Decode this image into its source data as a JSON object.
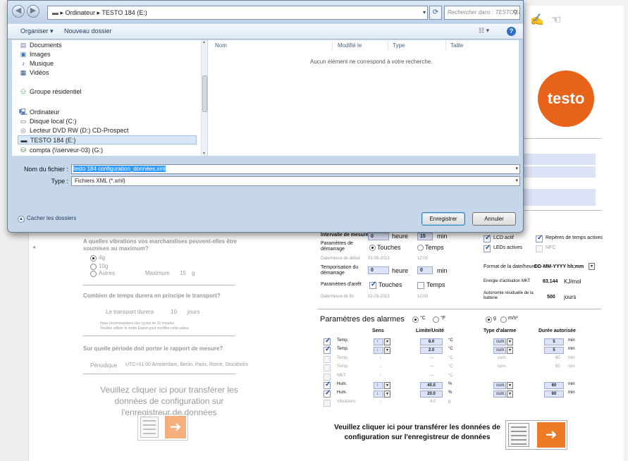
{
  "dialog": {
    "address": "▸ Ordinateur ▸ TESTO 184 (E:)",
    "search_placeholder": "Rechercher dans : TESTO 184 (E:)",
    "organize_label": "Organiser ▾",
    "new_folder_label": "Nouveau dossier",
    "nav_items": [
      {
        "label": "Documents",
        "icon": "documents-icon"
      },
      {
        "label": "Images",
        "icon": "images-icon"
      },
      {
        "label": "Musique",
        "icon": "music-icon"
      },
      {
        "label": "Vidéos",
        "icon": "videos-icon"
      },
      {
        "label": "Groupe résidentiel",
        "icon": "homegroup-icon"
      },
      {
        "label": "Ordinateur",
        "icon": "computer-icon"
      },
      {
        "label": "Disque local (C:)",
        "icon": "drive-icon"
      },
      {
        "label": "Lecteur DVD RW (D:) CD-Prospect",
        "icon": "dvd-icon"
      },
      {
        "label": "TESTO 184 (E:)",
        "icon": "usb-drive-icon"
      },
      {
        "label": "compta (\\\\serveur-03) (G:)",
        "icon": "network-drive-icon"
      }
    ],
    "columns": [
      "Nom",
      "Modifié le",
      "Type",
      "Taille"
    ],
    "empty_message": "Aucun élément ne correspond à votre recherche.",
    "filename_label": "Nom du fichier :",
    "filename_value": "testo 184 configuration_données.xml",
    "type_label": "Type :",
    "type_value": "Fichiers XML (*.xml)",
    "hide_folders_label": "Cacher les dossiers",
    "save_label": "Enregistrer",
    "cancel_label": "Annuler"
  },
  "background": {
    "logo_text": "testo",
    "vibrations_question": "A quelles vibrations vos marchandises peuvent-elles être soumises au maximum?",
    "vib_opt1": "4g",
    "vib_opt2": "10g",
    "vib_opt3": "Autres",
    "vib_max_label": "Maximum",
    "vib_max_value": "15",
    "vib_max_unit": "g",
    "duration_question": "Combien de temps durera en principe le transport?",
    "duration_label": "Le transport durera",
    "duration_value": "10",
    "duration_unit": "jours",
    "duration_note1": "Nous recommandons des cycles de 15 minutes.",
    "duration_note2": "Veuillez utiliser le mode Expert pour modifier cette valeur.",
    "period_question": "Sur quelle période doit porter le rapport de mesure?",
    "period_label": "Périodique",
    "period_value": "UTC+01:00 Amsterdam, Berlin, Paris, Rome, Stockholm",
    "transfer_left": "Veuillez cliquer ici pour transférer les données de configuration sur l'enregistreur de données",
    "measure_interval_label": "Intervalle de mesure",
    "measure_interval_h": "0",
    "measure_interval_h_unit": "heure",
    "measure_interval_m": "15",
    "measure_interval_m_unit": "min",
    "start_params_label": "Paramètres de démarrage",
    "start_opt_keys": "Touches",
    "start_opt_time": "Temps",
    "start_date_label": "Date/Heure de début",
    "start_date": "01-09-2013",
    "start_time": "12:00",
    "start_delay_label": "Temporisation du démarrage",
    "start_delay_h": "0",
    "start_delay_h_unit": "heure",
    "start_delay_m": "0",
    "start_delay_m_unit": "min",
    "stop_params_label": "Paramètres d'arrêt",
    "stop_opt_keys": "Touches",
    "stop_opt_time": "Temps",
    "end_date_label": "Date/Heure de fin",
    "end_date": "02-09-2013",
    "end_time": "12:00",
    "lcd_label": "LCD actif",
    "time_marks_label": "Repères de temps actives",
    "leds_label": "LEDs actives",
    "nfc_label": "NFC",
    "datetime_format_label": "Format de la date/heure",
    "datetime_format_value": "DD-MM-YYYY hh:mm",
    "mkt_label": "Energie d'activation MKT",
    "mkt_value": "83.144",
    "mkt_unit": "KJ/mol",
    "battery_label": "Autonomie résiduelle de la batterie",
    "battery_value": "500",
    "battery_unit": "jours",
    "alarm_title": "Paramètres des alarmes",
    "unit_c": "°C",
    "unit_f": "°F",
    "unit_g": "g",
    "unit_ms2": "m/s²",
    "alarm_headers": [
      "Sens",
      "Limite/Unité",
      "Type d'alarme",
      "Durée autorisée"
    ],
    "alarm_rows": [
      {
        "name": "Temp.",
        "dir": "↑",
        "limit": "8.0",
        "unit": "°C",
        "type": "cum.",
        "dur": "5",
        "dur_unit": "min",
        "on": true
      },
      {
        "name": "Temp.",
        "dir": "↓",
        "limit": "2.0",
        "unit": "°C",
        "type": "cum.",
        "dur": "5",
        "dur_unit": "min",
        "on": true
      },
      {
        "name": "Temp.",
        "dir": "↑",
        "limit": "—",
        "unit": "°C",
        "type": "cum.",
        "dur": "60",
        "dur_unit": "min",
        "on": false
      },
      {
        "name": "Temp.",
        "dir": "↓",
        "limit": "—",
        "unit": "°C",
        "type": "cum.",
        "dur": "60",
        "dur_unit": "min",
        "on": false
      },
      {
        "name": "MKT",
        "dir": "↑",
        "limit": "—",
        "unit": "°C",
        "type": "",
        "dur": "",
        "dur_unit": "",
        "on": false
      },
      {
        "name": "Hum.",
        "dir": "↑",
        "limit": "40.0",
        "unit": "%",
        "type": "cum.",
        "dur": "60",
        "dur_unit": "min",
        "on": true
      },
      {
        "name": "Hum.",
        "dir": "↓",
        "limit": "20.0",
        "unit": "%",
        "type": "cum.",
        "dur": "60",
        "dur_unit": "min",
        "on": true
      },
      {
        "name": "Vibrations",
        "dir": "↑",
        "limit": "4.0",
        "unit": "g",
        "type": "",
        "dur": "",
        "dur_unit": "",
        "on": false
      }
    ],
    "transfer_right": "Veuillez cliquer ici pour transférer les données de configuration sur l'enregistreur de données"
  },
  "colors": {
    "accent_orange": "#e8631a",
    "field_blue": "#dde3f7",
    "dialog_chrome": "#c7d7ea"
  }
}
